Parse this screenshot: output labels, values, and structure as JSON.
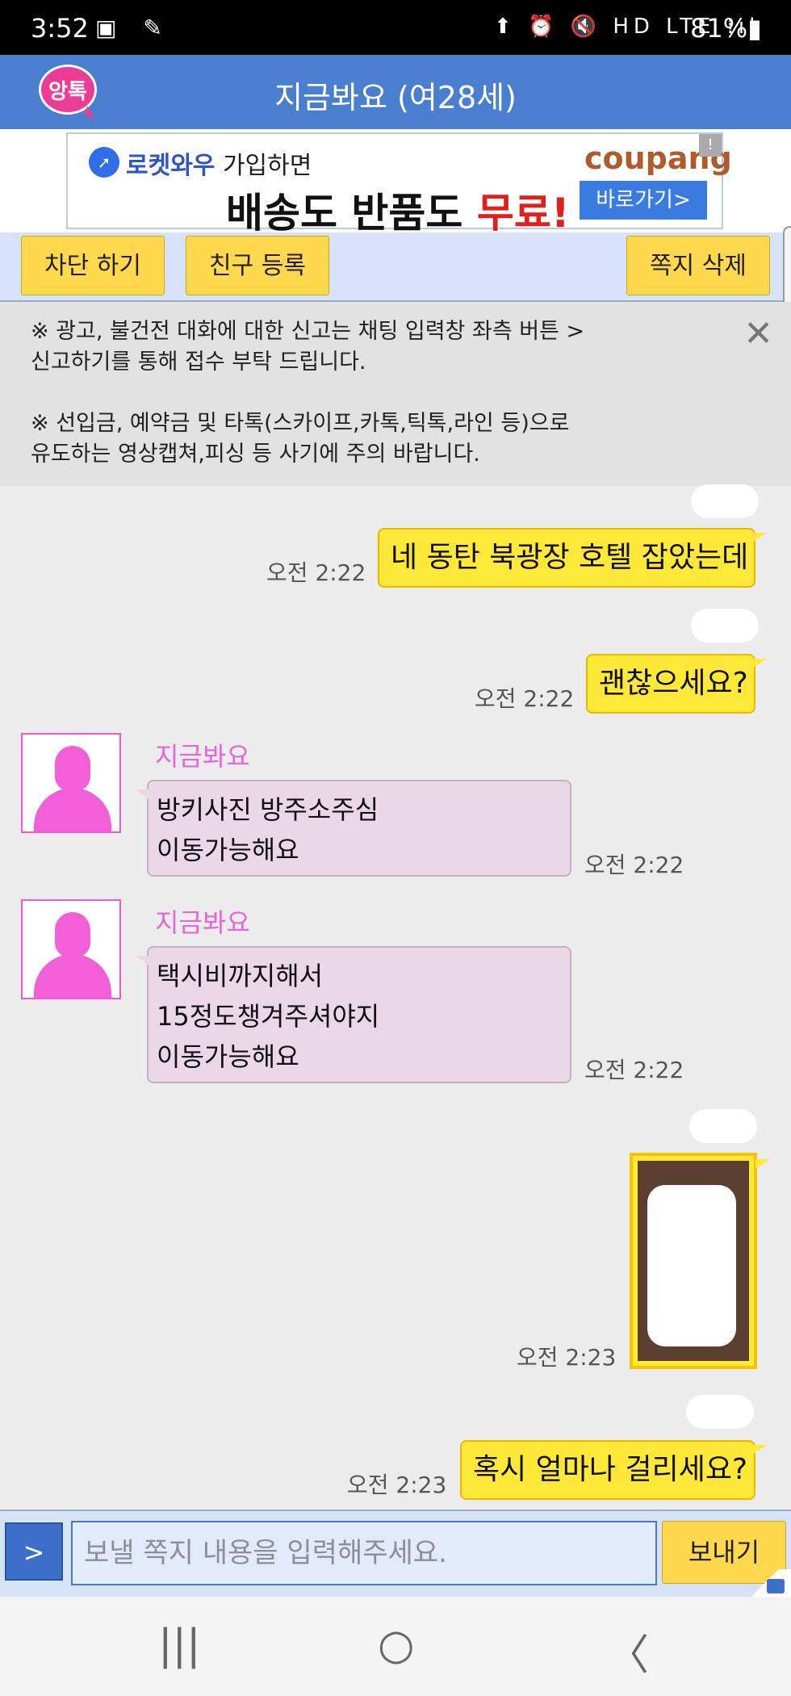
{
  "status_bar": {
    "time": "3:52",
    "left_icons": "▣ ✎",
    "right_icons": "⬆ ⏰ 🔇 HD LTE ⁞ıl",
    "battery": "81%▮"
  },
  "app_bar": {
    "logo": "앙톡",
    "title": "지금봐요 (여28세)"
  },
  "ad": {
    "brand_prefix": "로켓와우",
    "line1_suffix": " 가입하면",
    "line2_a": "배송도 반품도 ",
    "line2_b": "무료!",
    "brand": "coupang",
    "button": "바로가기>",
    "info_icon": "!"
  },
  "actions": {
    "block": "차단 하기",
    "add_friend": "친구 등록",
    "delete_note": "쪽지 삭제"
  },
  "notice": {
    "p1_line1": "※ 광고, 불건전 대화에 대한 신고는 채팅 입력창 좌측 버튼 >",
    "p1_line2": "신고하기를 통해 접수 부탁 드립니다.",
    "p2_line1": "※ 선입금, 예약금 및 타톡(스카이프,카톡,틱톡,라인 등)으로",
    "p2_line2": "유도하는 영상캡쳐,피싱 등 사기에 주의 바랍니다.",
    "close": "✕"
  },
  "messages": {
    "m1": {
      "text": "네 동탄 북광장 호텔 잡았는데",
      "time": "오전 2:22"
    },
    "m2": {
      "text": "괜찮으세요?",
      "time": "오전 2:22"
    },
    "m3": {
      "sender": "지금봐요",
      "line1": "방키사진 방주소주심",
      "line2": "이동가능해요",
      "time": "오전 2:22"
    },
    "m4": {
      "sender": "지금봐요",
      "line1": "택시비까지해서",
      "line2": "15정도챙겨주셔야지",
      "line3": "이동가능해요",
      "time": "오전 2:22"
    },
    "m5": {
      "time": "오전 2:23"
    },
    "m6": {
      "text": "혹시 얼마나 걸리세요?",
      "time": "오전 2:23"
    }
  },
  "input": {
    "expand": ">",
    "placeholder": "보낼 쪽지 내용을 입력해주세요.",
    "send": "보내기"
  },
  "nav": {
    "recents": "|||",
    "home": "○",
    "back": "〈"
  }
}
